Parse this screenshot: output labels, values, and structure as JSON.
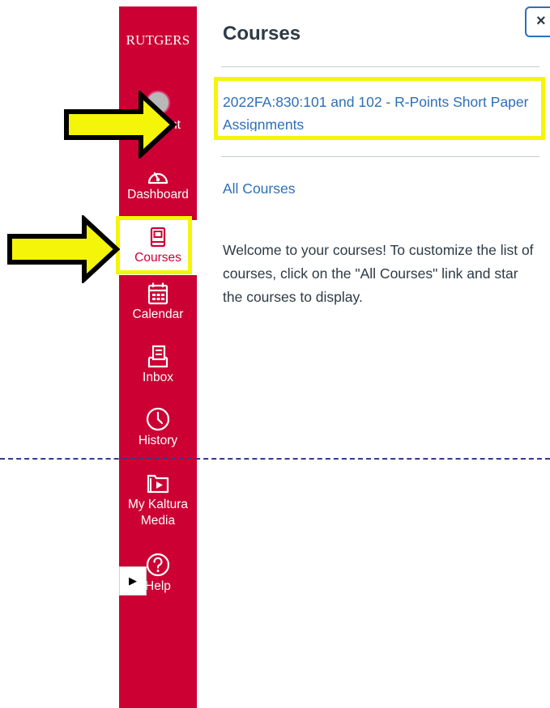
{
  "sidebar": {
    "logo": "RUTGERS",
    "items": [
      {
        "label": "Account",
        "icon": "avatar"
      },
      {
        "label": "Dashboard",
        "icon": "dashboard-icon"
      },
      {
        "label": "Courses",
        "icon": "courses-icon"
      },
      {
        "label": "Calendar",
        "icon": "calendar-icon"
      },
      {
        "label": "Inbox",
        "icon": "inbox-icon"
      },
      {
        "label": "History",
        "icon": "history-icon"
      },
      {
        "label": "My Kaltura Media",
        "icon": "kaltura-media-icon"
      },
      {
        "label": "Help",
        "icon": "help-icon"
      }
    ]
  },
  "tray": {
    "title": "Courses",
    "close_label": "×",
    "courses": [
      {
        "name": "2022FA:830:101 and 102 - R-Points Short Paper Assignments"
      }
    ],
    "all_courses_label": "All Courses",
    "welcome_text": "Welcome to your courses! To customize the list of courses, click on the \"All Courses\" link and star the courses to display."
  },
  "play_button_label": "▶",
  "colors": {
    "brand_red": "#cc0033",
    "link_blue": "#2d6fb8",
    "highlight_yellow": "#f5f50a",
    "text_dark": "#2d3b45"
  }
}
